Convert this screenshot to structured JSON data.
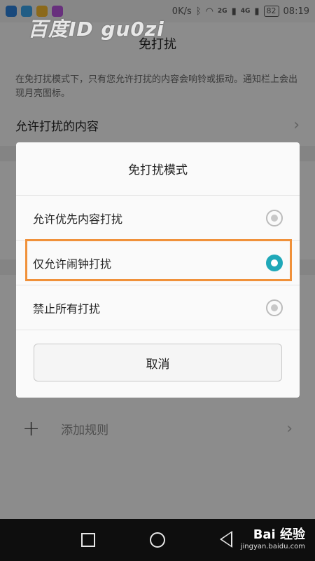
{
  "status_bar": {
    "speed": "0K/s",
    "net1": "2G",
    "net2": "4G",
    "battery": "82",
    "time": "08:19"
  },
  "watermark": "百度ID gu0zi",
  "header": {
    "title": "免打扰"
  },
  "description": "在免打扰模式下，只有您允许打扰的内容会响铃或振动。通知栏上会出现月亮图标。",
  "allowed_row": {
    "label": "允许打扰的内容"
  },
  "add_rule": {
    "label": "添加规则"
  },
  "dialog": {
    "title": "免打扰模式",
    "options": [
      {
        "label": "允许优先内容打扰",
        "selected": false
      },
      {
        "label": "仅允许闹钟打扰",
        "selected": true
      },
      {
        "label": "禁止所有打扰",
        "selected": false
      }
    ],
    "cancel_label": "取消"
  },
  "brand_logo": {
    "main": "Bai 经验",
    "sub": "jingyan.baidu.com"
  },
  "colors": {
    "accent": "#1fa8b8",
    "highlight": "#f0913a"
  }
}
